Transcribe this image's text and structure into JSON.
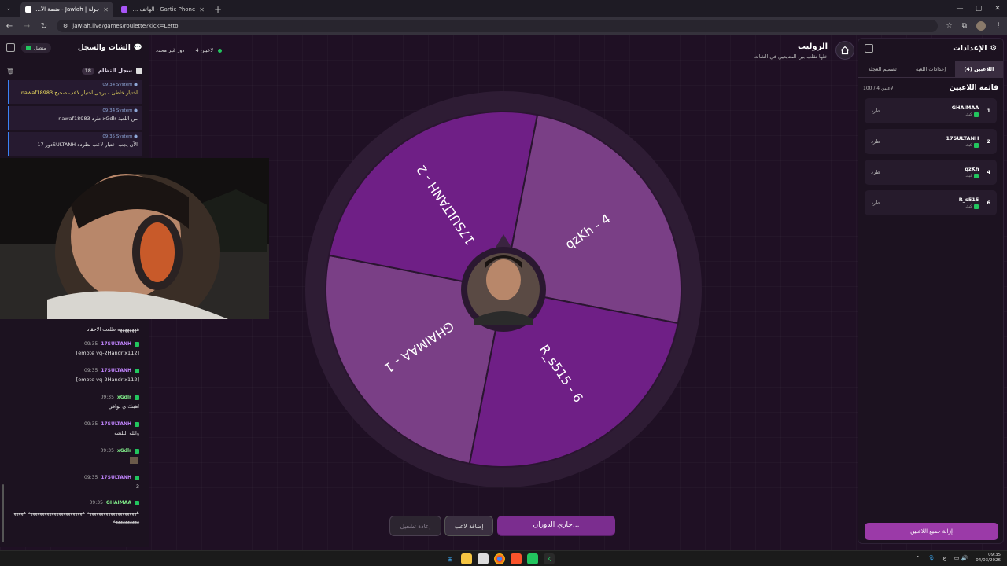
{
  "browser": {
    "tabs": [
      {
        "title": "جولة | Jawlah - منصة الألعاب ال",
        "active": true
      },
      {
        "title": "Gartic Phone - الهاتف المكسور -",
        "active": false
      }
    ],
    "url": "jawlah.live/games/roulette?kick=Letto"
  },
  "chat_panel": {
    "title": "الشات والسجل",
    "status": "متصل",
    "system_log": {
      "title": "سجل النظام",
      "count": "18"
    },
    "system_entries": [
      {
        "time": "09:34",
        "user": "System",
        "text": "nawaf18983 اختيار خاطئ - يرجى اختيار لاعب صحيح",
        "color": "#f0e060"
      },
      {
        "time": "09:34",
        "user": "System",
        "text": "nawaf18983 طرد xGdlr من اللعبة",
        "color": "#e0e0e0"
      },
      {
        "time": "09:35",
        "user": "System",
        "text": "دور 17SULTANH الآن يجب اختيار لاعب بطرده",
        "color": "#e0e0e0"
      }
    ],
    "messages": [
      {
        "time": "",
        "user": "",
        "text": "ههههههههه طلعت الاحقاد"
      },
      {
        "time": "09:35",
        "user": "17SULTANH",
        "text": "[emote vq-2Handrix112]"
      },
      {
        "time": "09:35",
        "user": "17SULTANH",
        "text": "[emote vq-2Handrix112]"
      },
      {
        "time": "09:35",
        "user": "xGdlr",
        "text": "اهبتك ي نوافي"
      },
      {
        "time": "09:35",
        "user": "17SULTANH",
        "text": "والله البلشه"
      },
      {
        "time": "09:35",
        "user": "xGdlr",
        "text": ""
      },
      {
        "time": "09:35",
        "user": "17SULTANH",
        "text": "3"
      },
      {
        "time": "09:35",
        "user": "GHAIMAA",
        "text": "هههههههههههههههههههههه هههههههههههههههههههههههه هههههههههههههههه"
      }
    ]
  },
  "topbar": {
    "players": "4 لاعبين",
    "turn": "دور غير محدد",
    "game_title": "الروليت",
    "game_subtitle": "خلها تقلب بين المتابعين في الشات"
  },
  "wheel": {
    "segments": [
      {
        "label": "GHAIMAA - 1",
        "color": "#7a3f86"
      },
      {
        "label": "17SULTANH - 2",
        "color": "#6f1f86"
      },
      {
        "label": "qzKh - 4",
        "color": "#7a3f86"
      },
      {
        "label": "R_s515 - 6",
        "color": "#6f1f86"
      }
    ],
    "rim_color": "#2e1c34"
  },
  "buttons": {
    "spin": "جاري الدوران...",
    "add_player": "إضافة لاعب",
    "reset": "إعادة تشغيل"
  },
  "settings_panel": {
    "title": "الإعدادات",
    "tabs": [
      "اللاعبين (4)",
      "إعدادات اللعبة",
      "تصميم العجلة"
    ],
    "list_title": "قائمة اللاعبين",
    "list_count": "100 / 4 لاعبين",
    "players": [
      {
        "num": "1",
        "name": "GHAIMAA",
        "platform": "كيك",
        "kick_label": "طرد"
      },
      {
        "num": "2",
        "name": "17SULTANH",
        "platform": "كيك",
        "kick_label": "طرد"
      },
      {
        "num": "4",
        "name": "qzKh",
        "platform": "كيك",
        "kick_label": "طرد"
      },
      {
        "num": "6",
        "name": "R_s515",
        "platform": "كيك",
        "kick_label": "طرد"
      }
    ],
    "clear_button": "إزالة جميع اللاعبين"
  },
  "taskbar": {
    "lang": "ع",
    "time": "09:35",
    "date": "04/03/2026"
  }
}
